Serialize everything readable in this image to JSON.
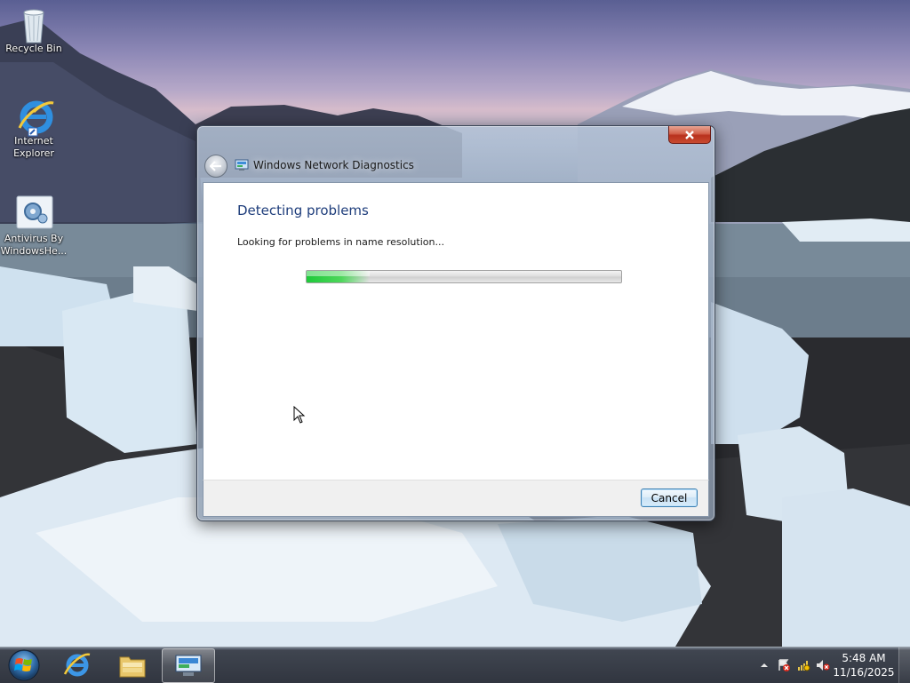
{
  "desktop": {
    "icons": [
      {
        "label": "Recycle Bin",
        "icon": "recycle-bin-icon"
      },
      {
        "label": "Internet Explorer",
        "icon": "internet-explorer-icon"
      },
      {
        "label": "Antivirus By WindowsHe...",
        "icon": "antivirus-icon"
      }
    ]
  },
  "window": {
    "title": "Windows Network Diagnostics",
    "heading": "Detecting problems",
    "status": "Looking for problems in name resolution...",
    "progress_fraction": 0.2,
    "cancel_label": "Cancel"
  },
  "taskbar": {
    "pinned": [
      {
        "name": "internet-explorer",
        "icon": "internet-explorer-icon"
      },
      {
        "name": "windows-explorer",
        "icon": "folder-icon"
      },
      {
        "name": "network-diagnostics",
        "icon": "network-diagnostics-icon",
        "active": true
      }
    ],
    "tray": {
      "time": "5:48 AM",
      "date": "11/16/2025",
      "icons": [
        "show-hidden-icons-icon",
        "action-center-icon",
        "network-icon",
        "volume-muted-icon"
      ]
    }
  },
  "colors": {
    "heading": "#1e3d7b",
    "progress": "#1dc939",
    "close": "#c8402a"
  }
}
